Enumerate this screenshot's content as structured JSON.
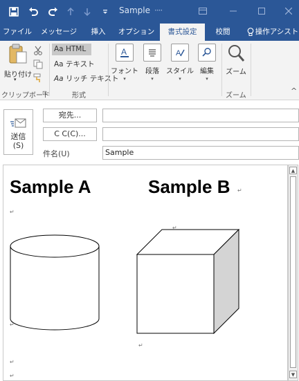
{
  "window": {
    "title": "Sample",
    "title_dots": "····"
  },
  "quick_access": {
    "save_icon": "save-icon",
    "undo_icon": "undo-icon",
    "redo_icon": "redo-icon",
    "up_icon": "arrow-up-icon",
    "down_icon": "arrow-down-icon",
    "customize_icon": "customize-icon"
  },
  "tabs": [
    {
      "label": "ファイル"
    },
    {
      "label": "メッセージ"
    },
    {
      "label": "挿入"
    },
    {
      "label": "オプション"
    },
    {
      "label": "書式設定"
    },
    {
      "label": "校閲"
    },
    {
      "label": "操作アシスト"
    }
  ],
  "ribbon": {
    "clipboard": {
      "paste_label": "貼り付け",
      "group_label": "クリップボード",
      "dialog_launcher": "⊡"
    },
    "format": {
      "html_label": "HTML",
      "html_prefix": "Aa",
      "text_label": "テキスト",
      "text_prefix": "Aa",
      "rich_label": "リッチ テキスト",
      "rich_prefix": "Aa",
      "group_label": "形式"
    },
    "font_label": "フォント",
    "paragraph_label": "段落",
    "style_label": "スタイル",
    "edit_label": "編集",
    "zoom_label": "ズーム",
    "zoom_group_label": "ズーム",
    "collapse_icon": "^"
  },
  "header": {
    "send_label_1": "送信",
    "send_label_2": "(S)",
    "to_button": "宛先...",
    "cc_button": "C C(C)...",
    "subject_label": "件名(U)",
    "to_value": "",
    "cc_value": "",
    "subject_value": "Sample"
  },
  "body": {
    "heading_a": "Sample A",
    "heading_b": "Sample B",
    "para_mark": "↵"
  },
  "colors": {
    "accent": "#2b5797",
    "ribbon_bg": "#f3f3f3",
    "cube_side": "#d4d4d4"
  }
}
